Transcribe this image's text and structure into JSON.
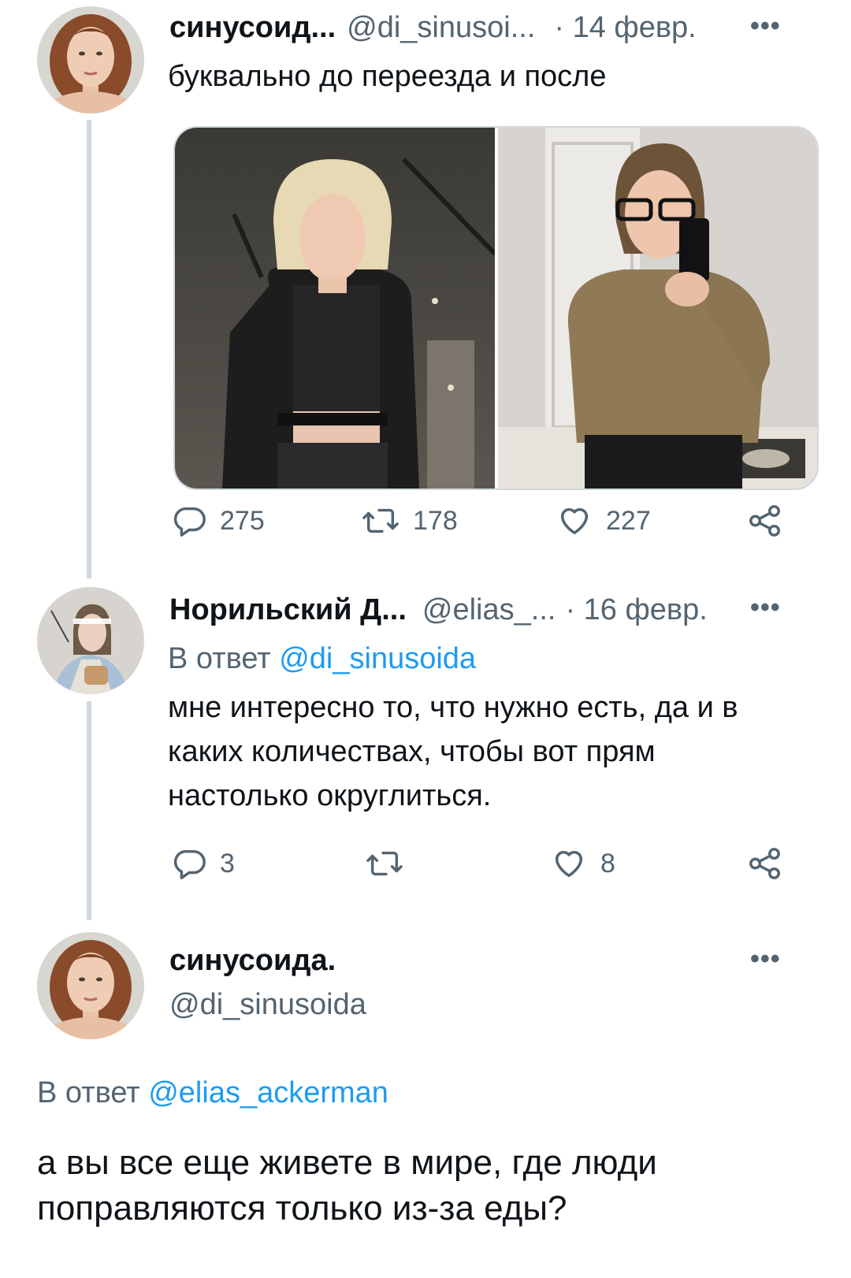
{
  "tweets": [
    {
      "display_name": "синусоид...",
      "handle": "@di_sinusoi...",
      "date": "· 14 февр.",
      "text": "буквально до переезда и после",
      "actions": {
        "replies": "275",
        "retweets": "178",
        "likes": "227"
      }
    },
    {
      "display_name": "Норильский Д...",
      "handle": "@elias_...",
      "date": "· 16 февр.",
      "reply_prefix": "В ответ",
      "reply_to": "@di_sinusoida",
      "text_lines": [
        "мне интересно то, что нужно есть, да и в",
        "каких количествах, чтобы вот прям",
        "настолько округлиться."
      ],
      "actions": {
        "replies": "3",
        "retweets": "",
        "likes": "8"
      }
    }
  ],
  "main_tweet": {
    "display_name": "синусоида.",
    "handle": "@di_sinusoida",
    "reply_prefix": "В ответ",
    "reply_to": "@elias_ackerman",
    "text_lines": [
      "а вы все еще живете в мире, где люди",
      "поправляются только из-за еды?"
    ]
  },
  "icons": {
    "more": "more-icon",
    "reply": "reply-icon",
    "retweet": "retweet-icon",
    "like": "heart-icon",
    "share": "share-icon"
  },
  "colors": {
    "link": "#1d9bf0",
    "secondary_text": "#536471",
    "thread_line": "#cfd9de"
  }
}
